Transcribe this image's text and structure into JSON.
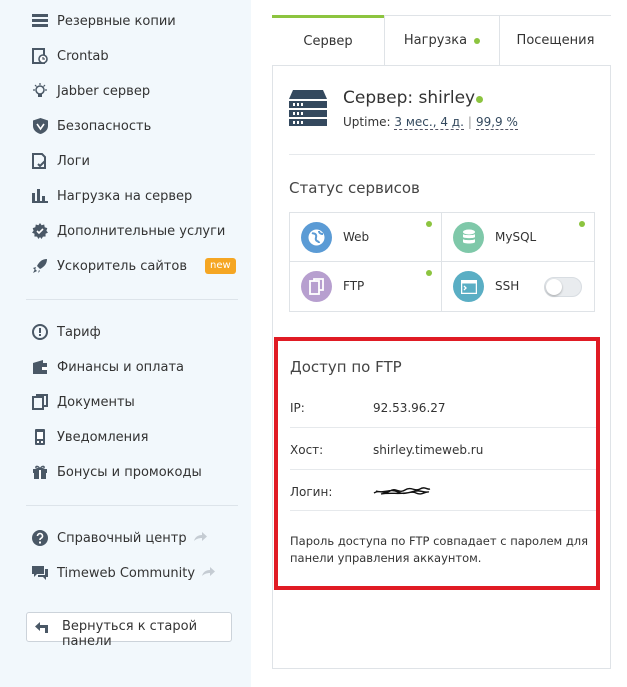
{
  "sidebar": {
    "items": [
      {
        "label": "Резервные копии",
        "icon": "backup-icon"
      },
      {
        "label": "Crontab",
        "icon": "crontab-icon"
      },
      {
        "label": "Jabber сервер",
        "icon": "bulb-icon"
      },
      {
        "label": "Безопасность",
        "icon": "shield-icon"
      },
      {
        "label": "Логи",
        "icon": "log-icon"
      },
      {
        "label": "Нагрузка на сервер",
        "icon": "bar-chart-icon"
      },
      {
        "label": "Дополнительные услуги",
        "icon": "gear-icon"
      },
      {
        "label": "Ускоритель сайтов",
        "icon": "rocket-icon",
        "badge": "new"
      }
    ],
    "items2": [
      {
        "label": "Тариф",
        "icon": "tariff-icon"
      },
      {
        "label": "Финансы и оплата",
        "icon": "wallet-icon"
      },
      {
        "label": "Документы",
        "icon": "documents-icon"
      },
      {
        "label": "Уведомления",
        "icon": "phone-icon"
      },
      {
        "label": "Бонусы и промокоды",
        "icon": "gift-icon"
      }
    ],
    "items3": [
      {
        "label": "Справочный центр",
        "icon": "help-icon"
      },
      {
        "label": "Timeweb Community",
        "icon": "chat-icon"
      }
    ],
    "back_button": "Вернуться к старой панели"
  },
  "tabs": [
    {
      "label": "Сервер",
      "active": true
    },
    {
      "label": "Нагрузка",
      "dot": true
    },
    {
      "label": "Посещения"
    }
  ],
  "server": {
    "title": "Сервер: shirley",
    "uptime_label": "Uptime:",
    "uptime_value": "3 мес., 4 д.",
    "uptime_percent": "99,9 %",
    "status_color": "#8cc43f"
  },
  "services": {
    "title": "Статус сервисов",
    "items": [
      {
        "name": "Web",
        "color": "#5b9bd5",
        "online": true
      },
      {
        "name": "MySQL",
        "color": "#7fc8a9",
        "online": true
      },
      {
        "name": "FTP",
        "color": "#b79fcf",
        "online": true
      },
      {
        "name": "SSH",
        "color": "#5aaec4",
        "toggle": false
      }
    ]
  },
  "ftp": {
    "title": "Доступ по FTP",
    "ip_label": "IP:",
    "ip_value": "92.53.96.27",
    "host_label": "Хост:",
    "host_value": "shirley.timeweb.ru",
    "login_label": "Логин:",
    "note": "Пароль доступа по FTP совпадает с паролем для панели управления аккаунтом.",
    "highlight_color": "#e01b24"
  }
}
